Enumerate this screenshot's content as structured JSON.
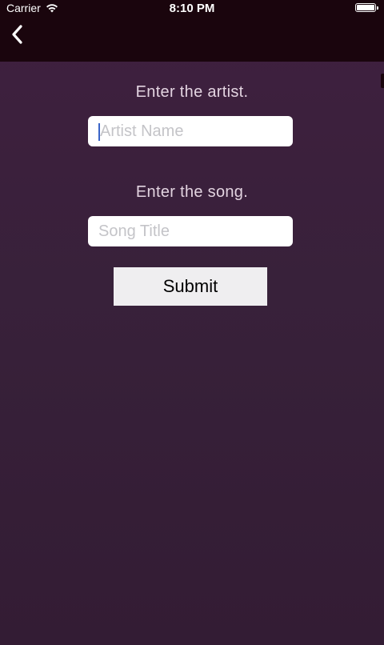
{
  "status_bar": {
    "carrier": "Carrier",
    "time": "8:10 PM",
    "wifi_icon": "wifi-icon",
    "battery_icon": "battery-icon"
  },
  "nav": {
    "back_icon": "chevron-left-icon"
  },
  "form": {
    "artist_prompt": "Enter the artist.",
    "artist_placeholder": "Artist Name",
    "artist_value": "",
    "song_prompt": "Enter the song.",
    "song_placeholder": "Song Title",
    "song_value": "",
    "submit_label": "Submit"
  },
  "colors": {
    "bar_background": "#1a050d",
    "screen_background": "#3a1f3b",
    "prompt_text": "#e2d3e0",
    "button_background": "#efeef0"
  }
}
